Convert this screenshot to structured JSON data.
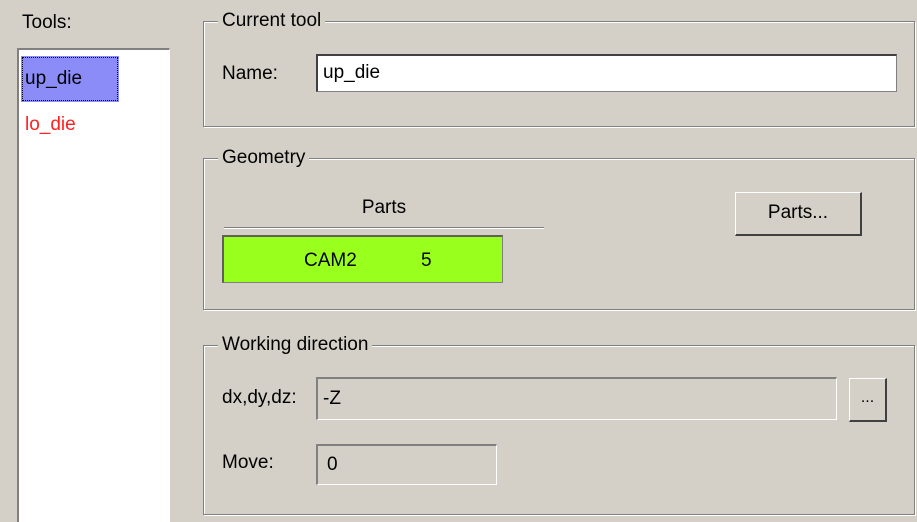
{
  "tools": {
    "label": "Tools:",
    "items": [
      {
        "label": "up_die",
        "selected": true,
        "color": "#000000"
      },
      {
        "label": "lo_die",
        "selected": false,
        "color": "#ff2020"
      }
    ]
  },
  "current_tool": {
    "title": "Current tool",
    "name_label": "Name:",
    "name_value": "up_die"
  },
  "geometry": {
    "title": "Geometry",
    "parts_header": "Parts",
    "parts_rows": [
      {
        "part": "CAM2",
        "count": "5",
        "color": "#99ff1c"
      }
    ],
    "parts_button": "Parts..."
  },
  "working_direction": {
    "title": "Working direction",
    "dxdy_label": "dx,dy,dz:",
    "dxdy_value": "-Z",
    "browse_button": "...",
    "move_label": "Move:",
    "move_value": "0"
  }
}
